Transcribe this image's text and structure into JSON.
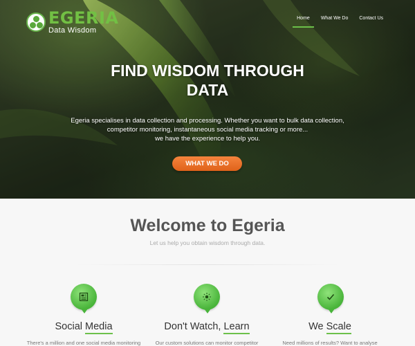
{
  "brand": {
    "name": "EGERIA",
    "tagline": "Data Wisdom",
    "accent": "#6cc04a",
    "cta_color": "#f07a32"
  },
  "nav": {
    "items": [
      {
        "label": "Home",
        "active": true
      },
      {
        "label": "What We Do",
        "active": false
      },
      {
        "label": "Contact Us",
        "active": false
      }
    ]
  },
  "hero": {
    "title_line1": "FIND WISDOM THROUGH",
    "title_line2": "DATA",
    "desc_line1": "Egeria specialises in data collection and processing. Whether you want to bulk data collection,",
    "desc_line2": "competitor monitoring, instantaneous social media tracking or more...",
    "desc_line3": "we have the experience to help you.",
    "cta_label": "WHAT WE DO"
  },
  "welcome": {
    "title": "Welcome to Egeria",
    "subtitle": "Let us help you obtain wisdom through data."
  },
  "features": [
    {
      "icon": "newspaper-icon",
      "title_pre": "Social ",
      "title_ul": "Media",
      "title_post": "",
      "text": "There's a million and one social media monitoring"
    },
    {
      "icon": "sun-icon",
      "title_pre": "Don't Watch, ",
      "title_ul": "Learn",
      "title_post": "",
      "text": "Our custom solutions can monitor competitor"
    },
    {
      "icon": "check-icon",
      "title_pre": "We ",
      "title_ul": "Scale",
      "title_post": "",
      "text": "Need millions of results? Want to analyse"
    }
  ]
}
